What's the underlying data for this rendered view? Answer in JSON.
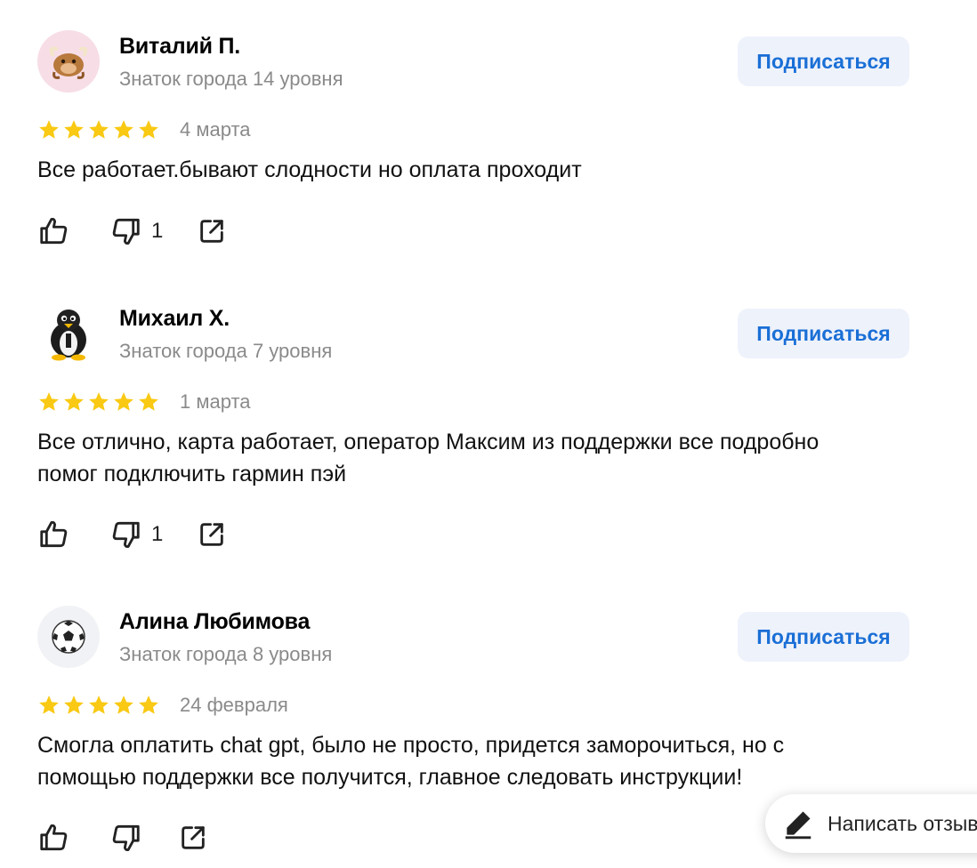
{
  "colors": {
    "star": "#f9c913",
    "subscribe_bg": "#eef2fb",
    "subscribe_text": "#1a6fd6",
    "muted": "#8a8a8a"
  },
  "reviews": [
    {
      "author": "Виталий П.",
      "level": "Знаток города 14 уровня",
      "avatar_icon": "yak-icon",
      "subscribe_label": "Подписаться",
      "rating": 5,
      "date": "4 марта",
      "text": "Все работает.бывают слодности но оплата проходит",
      "dislike_count": "1"
    },
    {
      "author": "Михаил Х.",
      "level": "Знаток города 7 уровня",
      "avatar_icon": "penguin-icon",
      "subscribe_label": "Подписаться",
      "rating": 5,
      "date": "1 марта",
      "text": "Все отлично, карта работает, оператор Максим из поддержки все подробно помог подключить гармин пэй",
      "dislike_count": "1"
    },
    {
      "author": "Алина Любимова",
      "level": "Знаток города 8 уровня",
      "avatar_icon": "soccer-ball-icon",
      "subscribe_label": "Подписаться",
      "rating": 5,
      "date": "24 февраля",
      "text": "Смогла оплатить chat gpt, было не просто, придется заморочиться, но с помощью поддержки все получится, главное следовать инструкции!",
      "dislike_count": ""
    }
  ],
  "write_review": {
    "label": "Написать отзыв",
    "icon": "pencil-icon"
  }
}
